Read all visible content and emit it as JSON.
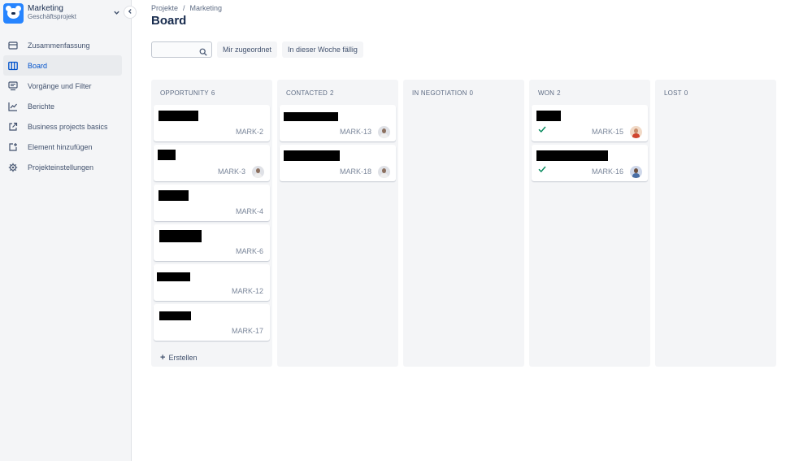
{
  "project": {
    "name": "Marketing",
    "type": "Geschäftsprojekt"
  },
  "icons": {
    "collapse": "chevron-left-icon",
    "dropdown": "chevron-down-icon"
  },
  "sidebar": {
    "items": [
      {
        "label": "Zusammenfassung",
        "icon": "summary-icon",
        "active": false
      },
      {
        "label": "Board",
        "icon": "board-icon",
        "active": true
      },
      {
        "label": "Vorgänge und Filter",
        "icon": "issues-icon",
        "active": false
      },
      {
        "label": "Berichte",
        "icon": "reports-icon",
        "active": false
      },
      {
        "label": "Business projects basics",
        "icon": "external-link-icon",
        "active": false
      },
      {
        "label": "Element hinzufügen",
        "icon": "add-item-icon",
        "active": false
      },
      {
        "label": "Projekteinstellungen",
        "icon": "gear-icon",
        "active": false
      }
    ]
  },
  "breadcrumb": {
    "root": "Projekte",
    "separator": "/",
    "current": "Marketing"
  },
  "page": {
    "title": "Board"
  },
  "toolbar": {
    "search_placeholder": "",
    "filters": [
      "Mir zugeordnet",
      "In dieser Woche fällig"
    ]
  },
  "board": {
    "columns": [
      {
        "name": "OPPORTUNITY",
        "count": "6",
        "cards": [
          {
            "key": "MARK-2"
          },
          {
            "key": "MARK-3"
          },
          {
            "key": "MARK-4"
          },
          {
            "key": "MARK-6"
          },
          {
            "key": "MARK-12"
          },
          {
            "key": "MARK-17"
          }
        ]
      },
      {
        "name": "CONTACTED",
        "count": "2",
        "cards": [
          {
            "key": "MARK-13"
          },
          {
            "key": "MARK-18"
          }
        ]
      },
      {
        "name": "IN NEGOTIATION",
        "count": "0",
        "cards": []
      },
      {
        "name": "WON",
        "count": "2",
        "cards": [
          {
            "key": "MARK-15"
          },
          {
            "key": "MARK-16"
          }
        ]
      },
      {
        "name": "LOST",
        "count": "0",
        "cards": []
      }
    ],
    "create_label": "Erstellen"
  },
  "colors": {
    "accent": "#0052cc",
    "done_check": "#00875a",
    "column_bg": "#f4f5f7"
  }
}
